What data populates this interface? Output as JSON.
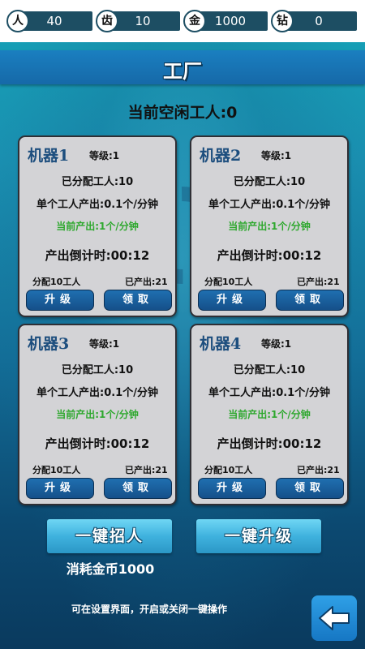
{
  "resources": [
    {
      "icon_char": "人",
      "icon": "person-icon",
      "value": "40"
    },
    {
      "icon_char": "齿",
      "icon": "gear-tooth-icon",
      "value": "10"
    },
    {
      "icon_char": "金",
      "icon": "gold-icon",
      "value": "1000"
    },
    {
      "icon_char": "钻",
      "icon": "diamond-icon",
      "value": "0"
    }
  ],
  "header": {
    "title": "工厂"
  },
  "idle_workers": "当前空闲工人:0",
  "machines": [
    {
      "name": "机器1",
      "level": "等级:1",
      "assigned": "已分配工人:10",
      "per_worker": "单个工人产出:0.1个/分钟",
      "current_output": "当前产出:1个/分钟",
      "countdown": "产出倒计时:00:12",
      "assign_label": "分配10工人",
      "produced": "已产出:21",
      "upgrade": "升级",
      "collect": "领取"
    },
    {
      "name": "机器2",
      "level": "等级:1",
      "assigned": "已分配工人:10",
      "per_worker": "单个工人产出:0.1个/分钟",
      "current_output": "当前产出:1个/分钟",
      "countdown": "产出倒计时:00:12",
      "assign_label": "分配10工人",
      "produced": "已产出:21",
      "upgrade": "升级",
      "collect": "领取"
    },
    {
      "name": "机器3",
      "level": "等级:1",
      "assigned": "已分配工人:10",
      "per_worker": "单个工人产出:0.1个/分钟",
      "current_output": "当前产出:1个/分钟",
      "countdown": "产出倒计时:00:12",
      "assign_label": "分配10工人",
      "produced": "已产出:21",
      "upgrade": "升级",
      "collect": "领取"
    },
    {
      "name": "机器4",
      "level": "等级:1",
      "assigned": "已分配工人:10",
      "per_worker": "单个工人产出:0.1个/分钟",
      "current_output": "当前产出:1个/分钟",
      "countdown": "产出倒计时:00:12",
      "assign_label": "分配10工人",
      "produced": "已产出:21",
      "upgrade": "升级",
      "collect": "领取"
    }
  ],
  "actions": {
    "recruit_all": "一键招人",
    "upgrade_all": "一键升级",
    "cost": "消耗金币1000",
    "hint": "可在设置界面，开启或关闭一键操作"
  },
  "colors": {
    "accent": "#1669a8",
    "green_text": "#2ea82e",
    "card_bg": "#d3d3d6"
  },
  "back_button": {
    "icon": "back-arrow-icon"
  }
}
